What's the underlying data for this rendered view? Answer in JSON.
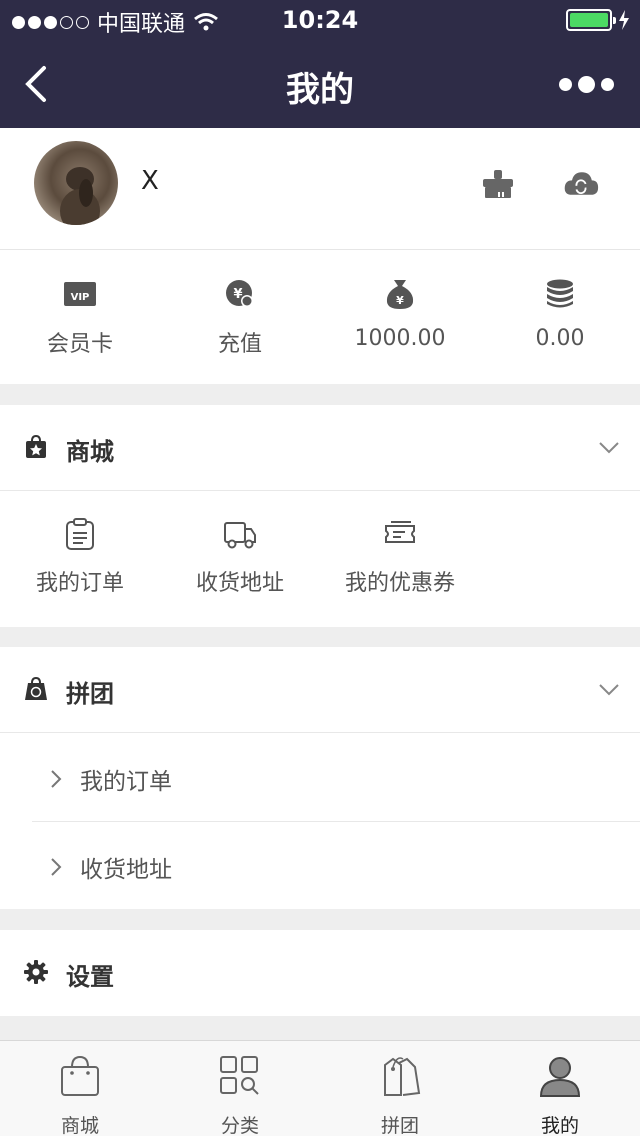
{
  "status_bar": {
    "carrier": "中国联通",
    "time": "10:24"
  },
  "header": {
    "title": "我的"
  },
  "profile": {
    "name": "X"
  },
  "stats": [
    {
      "label": "会员卡",
      "icon": "vip-card-icon"
    },
    {
      "label": "充值",
      "icon": "recharge-icon"
    },
    {
      "label": "1000.00",
      "icon": "money-bag-icon"
    },
    {
      "label": "0.00",
      "icon": "coins-icon"
    }
  ],
  "mall": {
    "title": "商城",
    "items": [
      {
        "label": "我的订单",
        "icon": "order-icon"
      },
      {
        "label": "收货地址",
        "icon": "truck-icon"
      },
      {
        "label": "我的优惠券",
        "icon": "coupon-icon"
      }
    ]
  },
  "group": {
    "title": "拼团",
    "items": [
      {
        "label": "我的订单"
      },
      {
        "label": "收货地址"
      }
    ]
  },
  "settings": {
    "title": "设置"
  },
  "tabs": [
    {
      "label": "商城",
      "icon": "shopping-bag-icon"
    },
    {
      "label": "分类",
      "icon": "category-grid-icon"
    },
    {
      "label": "拼团",
      "icon": "tag-icon"
    },
    {
      "label": "我的",
      "icon": "user-icon"
    }
  ],
  "colors": {
    "header_bg": "#2e2c47",
    "battery": "#4cd964"
  }
}
